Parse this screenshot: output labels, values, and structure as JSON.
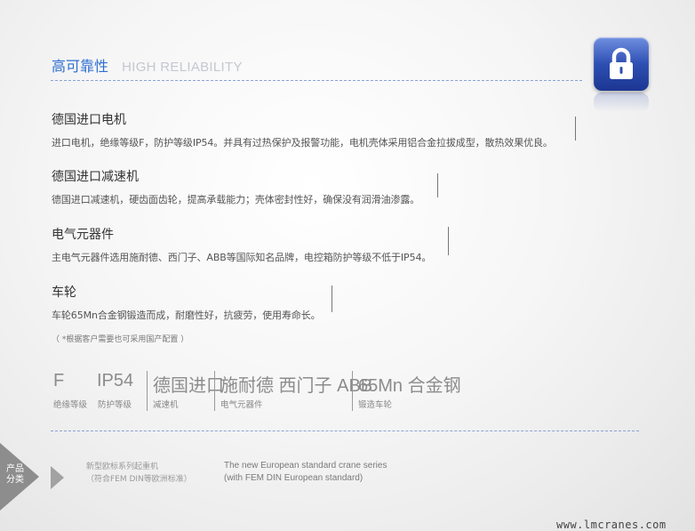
{
  "header": {
    "title_cn": "高可靠性",
    "title_en": "HIGH RELIABILITY"
  },
  "sections": [
    {
      "title": "德国进口电机",
      "desc": "进口电机，绝缘等级F，防护等级IP54。并具有过热保护及报警功能，电机壳体采用铝合金拉拔成型，散热效果优良。"
    },
    {
      "title": "德国进口减速机",
      "desc": "德国进口减速机，硬齿面齿轮，提高承载能力；壳体密封性好，确保没有润滑油渗露。"
    },
    {
      "title": "电气元器件",
      "desc": "主电气元器件选用施耐德、西门子、ABB等国际知名品牌，电控箱防护等级不低于IP54。"
    },
    {
      "title": "车轮",
      "desc": "车轮65Mn合金钢锻造而成，耐磨性好，抗疲劳，使用寿命长。"
    }
  ],
  "note": "（ *根据客户需要也可采用国产配置 ）",
  "specs": [
    {
      "big": "F",
      "small": "绝缘等级"
    },
    {
      "big": "IP54",
      "small": "防护等级"
    },
    {
      "big": "德国进口",
      "small": "减速机"
    },
    {
      "big": "施耐德 西门子 ABB",
      "small": "电气元器件"
    },
    {
      "big": "65Mn 合金钢",
      "small": "锻造车轮"
    }
  ],
  "footer": {
    "category_line1": "产品",
    "category_line2": "分类",
    "series_cn_line1": "新型欧标系列起重机",
    "series_cn_line2": "（符合FEM DIN等欧洲标准）",
    "series_en_line1": "The new European standard crane series",
    "series_en_line2": " (with FEM DIN European standard)"
  },
  "website": "www.lmcranes.com",
  "colors": {
    "accent": "#2f6fd1",
    "lock_tile": "#2d4fb3",
    "dashed_rule": "#8aa2d6"
  },
  "icons": {
    "lock": "padlock-icon"
  }
}
